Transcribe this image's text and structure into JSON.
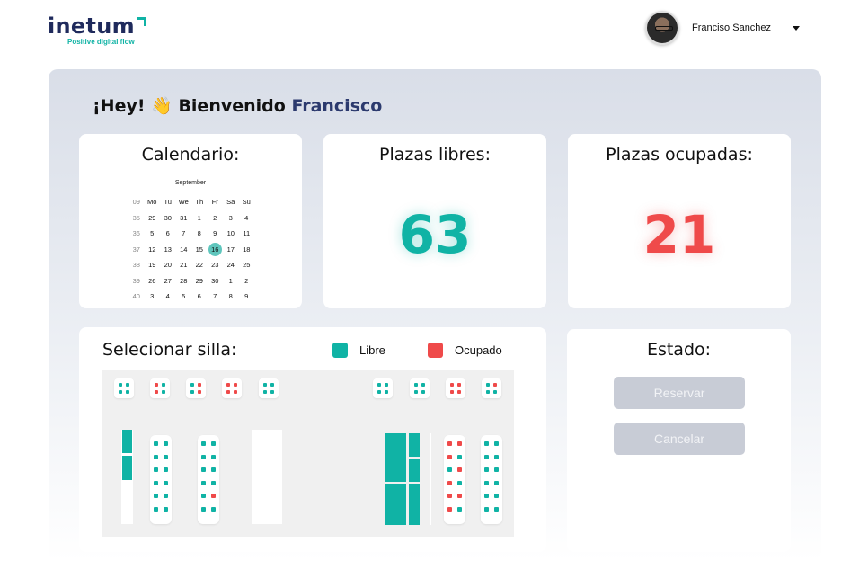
{
  "brand": {
    "name": "inetum",
    "tagline": "Positive digital flow",
    "accent": "#10b3a5",
    "navy": "#1f2a5c"
  },
  "user": {
    "name": "Franciso Sanchez"
  },
  "greeting": {
    "prefix": "¡Hey!",
    "emoji": "👋",
    "middle": "Bienvenido",
    "name": "Francisco"
  },
  "calendar": {
    "title": "Calendario:",
    "month": "September",
    "header": [
      "09",
      "Mo",
      "Tu",
      "We",
      "Th",
      "Fr",
      "Sa",
      "Su"
    ],
    "weeks": [
      [
        "35",
        "29",
        "30",
        "31",
        "1",
        "2",
        "3",
        "4"
      ],
      [
        "36",
        "5",
        "6",
        "7",
        "8",
        "9",
        "10",
        "11"
      ],
      [
        "37",
        "12",
        "13",
        "14",
        "15",
        "16",
        "17",
        "18"
      ],
      [
        "38",
        "19",
        "20",
        "21",
        "22",
        "23",
        "24",
        "25"
      ],
      [
        "39",
        "26",
        "27",
        "28",
        "29",
        "30",
        "1",
        "2"
      ],
      [
        "40",
        "3",
        "4",
        "5",
        "6",
        "7",
        "8",
        "9"
      ]
    ],
    "selected_day": "16"
  },
  "free_seats": {
    "title": "Plazas libres:",
    "value": "63"
  },
  "occupied_seats": {
    "title": "Plazas ocupadas:",
    "value": "21"
  },
  "seat_map": {
    "title": "Selecionar silla:",
    "legend_free": "Libre",
    "legend_occupied": "Ocupado",
    "free_color": "#10b3a5",
    "occupied_color": "#ef4a4a"
  },
  "status": {
    "title": "Estado:",
    "reserve_label": "Reservar",
    "cancel_label": "Cancelar"
  }
}
